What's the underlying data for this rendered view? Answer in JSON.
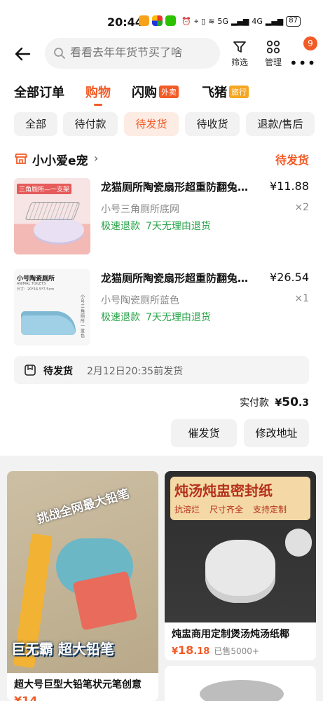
{
  "status_bar": {
    "time": "20:44",
    "network": "5G",
    "network2": "4G",
    "battery": "87"
  },
  "header": {
    "search_placeholder": "看看去年年货节买了啥",
    "filter_label": "筛选",
    "manage_label": "管理",
    "badge_count": "9"
  },
  "tabs": [
    {
      "label": "全部订单",
      "tag": ""
    },
    {
      "label": "购物",
      "tag": ""
    },
    {
      "label": "闪购",
      "tag": "外卖"
    },
    {
      "label": "飞猪",
      "tag": "旅行"
    }
  ],
  "filters": [
    "全部",
    "待付款",
    "待发货",
    "待收货",
    "退款/售后"
  ],
  "order": {
    "shop_name": "小小爱e宠",
    "status": "待发货",
    "items": [
      {
        "title": "龙猫厕所陶瓷扇形超重防翻兔子厕所",
        "price": "¥11.88",
        "spec": "小号三角厕所底网",
        "qty": "×2",
        "service1": "极速退款",
        "service2": "7天无理由退货",
        "thumb_caption": "三角厕所—一支架"
      },
      {
        "title": "龙猫厕所陶瓷扇形超重防翻兔子厕所",
        "price": "¥26.54",
        "spec": "小号陶瓷厕所蓝色",
        "qty": "×1",
        "service1": "极速退款",
        "service2": "7天无理由退货",
        "thumb_caption": "小号陶瓷厕所",
        "thumb_sub": "ANIMAL TOILETS",
        "thumb_size": "尺寸：20*16.5*7.5cm",
        "thumb_side": "小号三角厕所一蓝色"
      }
    ],
    "ship_label": "待发货",
    "ship_deadline": "2月12日20:35前发货",
    "total_label": "实付款",
    "total_currency": "¥",
    "total_int": "50",
    "total_dec": ".3",
    "btn_urge": "催发货",
    "btn_address": "修改地址"
  },
  "recommendations": [
    {
      "title": "超大号巨型大铅笔状元笔创意",
      "price": "¥14",
      "sold": "",
      "overlay_top": "挑战全网最大铅笔",
      "overlay_bottom": "巨无霸 超大铅笔"
    },
    {
      "title": "炖盅商用定制煲汤炖汤纸椰",
      "price_symbol": "¥",
      "price_int": "18",
      "price_dec": ".18",
      "sold": "已售5000+",
      "banner_title": "炖汤炖盅密封纸",
      "banner_tags": [
        "抗溶烂",
        "尺寸齐全",
        "支持定制"
      ]
    }
  ],
  "colors": {
    "accent": "#f25a26",
    "service_green": "#2aa34a"
  }
}
